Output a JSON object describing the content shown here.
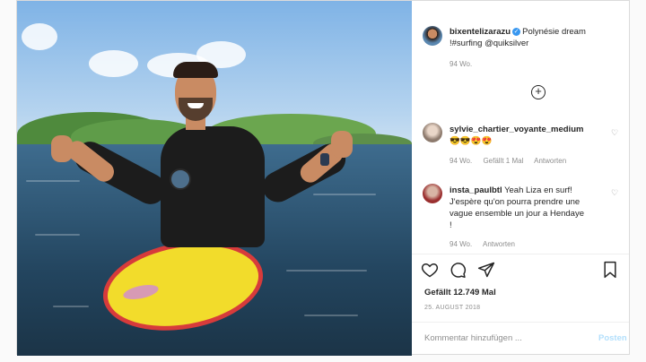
{
  "post": {
    "username": "bixentelizarazu",
    "caption": "Polynésie dream",
    "caption_line2": "!#surfing @quiksilver",
    "time": "94 Wo."
  },
  "comments": [
    {
      "username": "sylvie_chartier_voyante_medium",
      "text": "😎😎😍😍",
      "time": "94 Wo.",
      "likes": "Gefällt 1 Mal",
      "reply": "Antworten"
    },
    {
      "username": "insta_paulbtl",
      "text_line1": "Yeah Liza en surf!",
      "text_line2": "J'espère qu'on pourra prendre une",
      "text_line3": "vague ensemble un jour a Hendaye",
      "text_line4": "!",
      "time": "94 Wo.",
      "reply": "Antworten"
    }
  ],
  "likes": "Gefällt 12.749 Mal",
  "date": "25. AUGUST 2018",
  "comment_placeholder": "Kommentar hinzufügen ...",
  "post_button": "Posten",
  "icons": [
    "heart-icon",
    "comment-icon",
    "share-icon",
    "bookmark-icon",
    "load-more-icon",
    "verified-icon"
  ]
}
